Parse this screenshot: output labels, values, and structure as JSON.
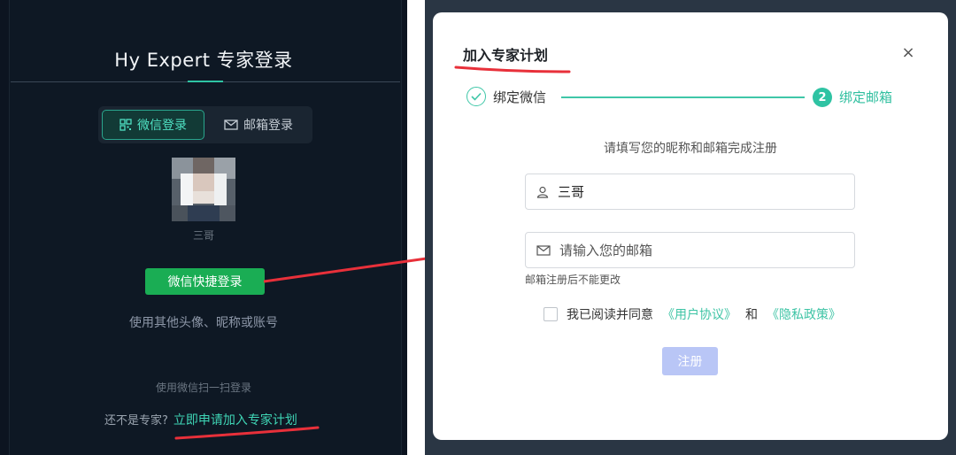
{
  "left_panel": {
    "title": "Hy Expert 专家登录",
    "tabs": [
      {
        "label": "微信登录",
        "icon": "qrcode-icon",
        "active": true
      },
      {
        "label": "邮箱登录",
        "icon": "mail-icon",
        "active": false
      }
    ],
    "avatar_name": "三哥",
    "wechat_button": "微信快捷登录",
    "other_link": "使用其他头像、昵称或账号",
    "scan_hint": "使用微信扫一扫登录",
    "not_expert": "还不是专家?",
    "apply_link": "立即申请加入专家计划"
  },
  "modal": {
    "title": "加入专家计划",
    "close": "×",
    "steps": [
      {
        "label": "绑定微信",
        "status": "done",
        "icon": "check-icon"
      },
      {
        "label": "绑定邮箱",
        "status": "current",
        "number": "2"
      }
    ],
    "instruction": "请填写您的昵称和邮箱完成注册",
    "name_value": "三哥",
    "email_placeholder": "请输入您的邮箱",
    "email_help": "邮箱注册后不能更改",
    "agree_text": "我已阅读并同意",
    "user_agreement": "《用户协议》",
    "and_text": "和",
    "privacy_policy": "《隐私政策》",
    "register_button": "注册"
  },
  "colors": {
    "accent_teal": "#2fc3a3",
    "wechat_green": "#1aad54",
    "annotation_red": "#e8303a",
    "register_disabled": "#b9c6f6",
    "left_bg": "#0e1824"
  }
}
